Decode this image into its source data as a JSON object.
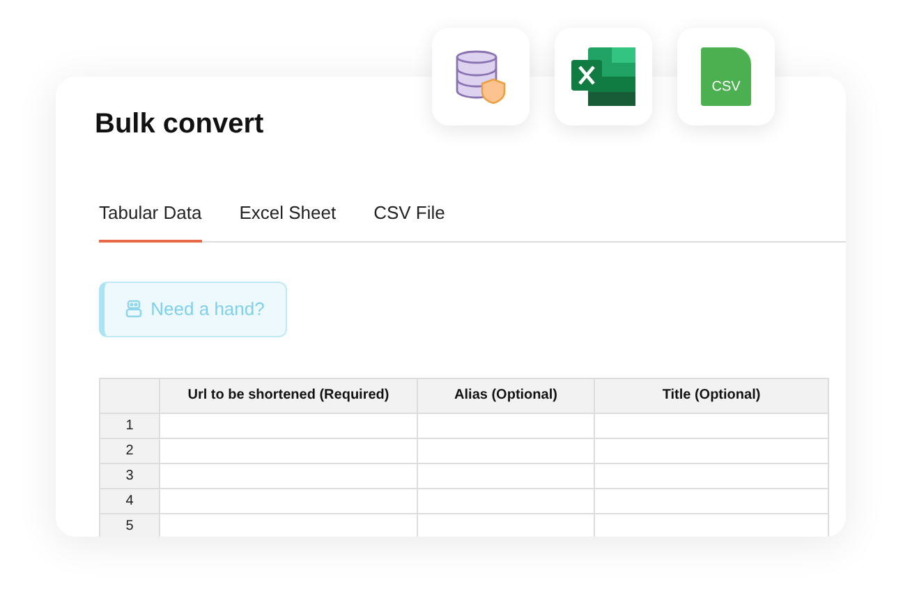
{
  "format_icons": {
    "csv_label": "CSV"
  },
  "title": "Bulk convert",
  "tabs": [
    {
      "label": "Tabular Data",
      "selected": true
    },
    {
      "label": "Excel Sheet",
      "selected": false
    },
    {
      "label": "CSV File",
      "selected": false
    }
  ],
  "help_button": {
    "label": "Need a hand?"
  },
  "table": {
    "columns": [
      "Url to be shortened (Required)",
      "Alias (Optional)",
      "Title (Optional)"
    ],
    "rows": [
      "1",
      "2",
      "3",
      "4",
      "5"
    ]
  }
}
